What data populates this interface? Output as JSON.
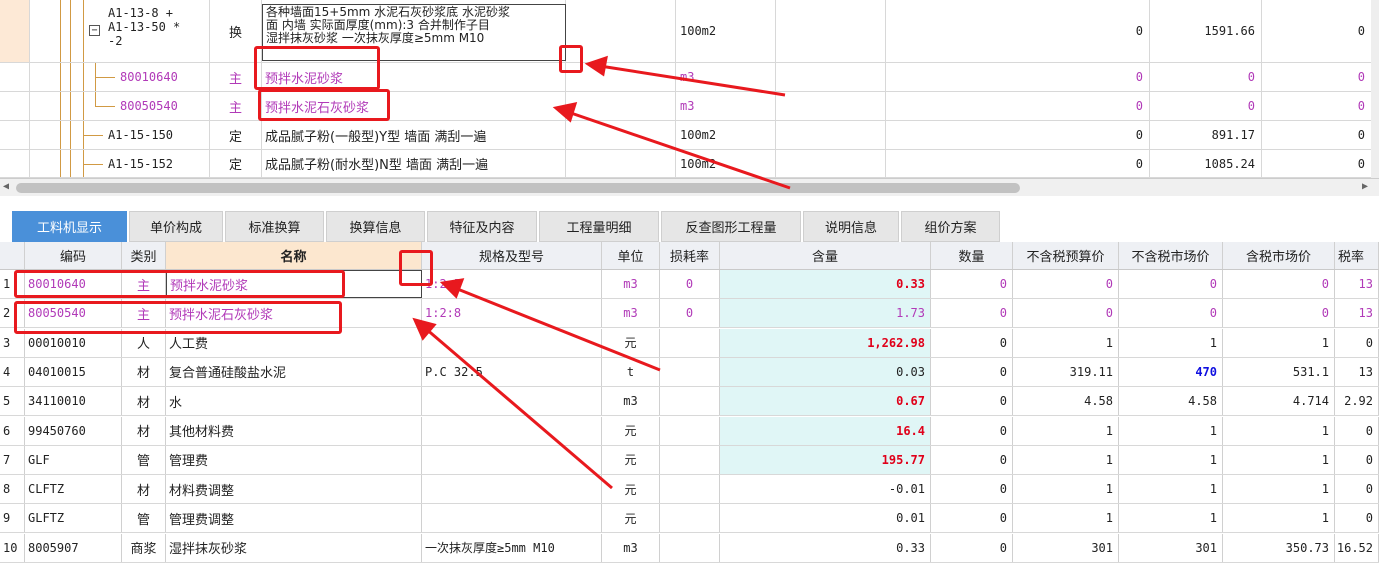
{
  "top_table": {
    "rows": [
      {
        "code_lines": [
          "A1-13-8 +",
          "A1-13-50 *",
          "-2"
        ],
        "type": "换",
        "name_lines": [
          "各种墙面15+5mm 水泥石灰砂浆底 水泥砂浆",
          "面 内墙 实际面厚度(mm):3 合并制作子目",
          "湿拌抹灰砂浆 一次抹灰厚度≥5mm M10"
        ],
        "unit": "100m2",
        "v1": "0",
        "v2": "1591.66",
        "v3": "0"
      },
      {
        "code": "80010640",
        "type": "主",
        "name": "预拌水泥砂浆",
        "unit": "m3",
        "v1": "0",
        "v2": "0",
        "v3": "0"
      },
      {
        "code": "80050540",
        "type": "主",
        "name": "预拌水泥石灰砂浆",
        "unit": "m3",
        "v1": "0",
        "v2": "0",
        "v3": "0"
      },
      {
        "code": "A1-15-150",
        "type": "定",
        "name": "成品腻子粉(一般型)Y型 墙面 满刮一遍",
        "unit": "100m2",
        "v1": "0",
        "v2": "891.17",
        "v3": "0"
      },
      {
        "code": "A1-15-152",
        "type": "定",
        "name": "成品腻子粉(耐水型)N型 墙面 满刮一遍",
        "unit": "100m2",
        "v1": "0",
        "v2": "1085.24",
        "v3": "0"
      }
    ]
  },
  "tabs": [
    "工料机显示",
    "单价构成",
    "标准换算",
    "换算信息",
    "特征及内容",
    "工程量明细",
    "反查图形工程量",
    "说明信息",
    "组价方案"
  ],
  "columns": [
    "编码",
    "类别",
    "名称",
    "规格及型号",
    "单位",
    "损耗率",
    "含量",
    "数量",
    "不含税预算价",
    "不含税市场价",
    "含税市场价",
    "税率"
  ],
  "rows": [
    {
      "n": "1",
      "code": "80010640",
      "type": "主",
      "name": "预拌水泥砂浆",
      "spec": "1:2.5",
      "unit": "m3",
      "loss": "0",
      "content": "0.33",
      "qty": "0",
      "p1": "0",
      "p2": "0",
      "p3": "0",
      "tax": "13"
    },
    {
      "n": "2",
      "code": "80050540",
      "type": "主",
      "name": "预拌水泥石灰砂浆",
      "spec": "1:2:8",
      "unit": "m3",
      "loss": "0",
      "content": "1.73",
      "qty": "0",
      "p1": "0",
      "p2": "0",
      "p3": "0",
      "tax": "13"
    },
    {
      "n": "3",
      "code": "00010010",
      "type": "人",
      "name": "人工费",
      "spec": "",
      "unit": "元",
      "loss": "",
      "content": "1,262.98",
      "qty": "0",
      "p1": "1",
      "p2": "1",
      "p3": "1",
      "tax": "0"
    },
    {
      "n": "4",
      "code": "04010015",
      "type": "材",
      "name": "复合普通硅酸盐水泥",
      "spec": "P.C 32.5",
      "unit": "t",
      "loss": "",
      "content": "0.03",
      "qty": "0",
      "p1": "319.11",
      "p2": "470",
      "p3": "531.1",
      "tax": "13"
    },
    {
      "n": "5",
      "code": "34110010",
      "type": "材",
      "name": "水",
      "spec": "",
      "unit": "m3",
      "loss": "",
      "content": "0.67",
      "qty": "0",
      "p1": "4.58",
      "p2": "4.58",
      "p3": "4.714",
      "tax": "2.92"
    },
    {
      "n": "6",
      "code": "99450760",
      "type": "材",
      "name": "其他材料费",
      "spec": "",
      "unit": "元",
      "loss": "",
      "content": "16.4",
      "qty": "0",
      "p1": "1",
      "p2": "1",
      "p3": "1",
      "tax": "0"
    },
    {
      "n": "7",
      "code": "GLF",
      "type": "管",
      "name": "管理费",
      "spec": "",
      "unit": "元",
      "loss": "",
      "content": "195.77",
      "qty": "0",
      "p1": "1",
      "p2": "1",
      "p3": "1",
      "tax": "0"
    },
    {
      "n": "8",
      "code": "CLFTZ",
      "type": "材",
      "name": "材料费调整",
      "spec": "",
      "unit": "元",
      "loss": "",
      "content": "-0.01",
      "qty": "0",
      "p1": "1",
      "p2": "1",
      "p3": "1",
      "tax": "0"
    },
    {
      "n": "9",
      "code": "GLFTZ",
      "type": "管",
      "name": "管理费调整",
      "spec": "",
      "unit": "元",
      "loss": "",
      "content": "0.01",
      "qty": "0",
      "p1": "1",
      "p2": "1",
      "p3": "1",
      "tax": "0"
    },
    {
      "n": "10",
      "code": "8005907",
      "type": "商浆",
      "name": "湿拌抹灰砂浆",
      "spec": "一次抹灰厚度≥5mm M10",
      "unit": "m3",
      "loss": "",
      "content": "0.33",
      "qty": "0",
      "p1": "301",
      "p2": "301",
      "p3": "350.73",
      "tax": "16.52"
    }
  ]
}
